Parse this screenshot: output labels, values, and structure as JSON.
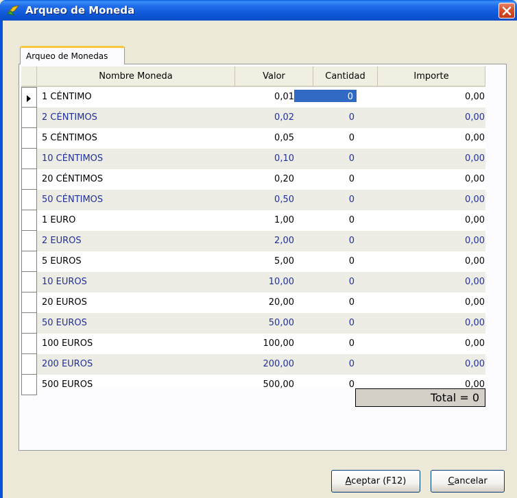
{
  "window": {
    "title": "Arqueo de Moneda",
    "title_color": "#FFFFFF",
    "titlebar_color": "#0A5FE3"
  },
  "tab": {
    "label": "Arqueo de Monedas"
  },
  "grid": {
    "columns": [
      "Nombre Moneda",
      "Valor",
      "Cantidad",
      "Importe"
    ],
    "rows": [
      {
        "nombre": "1 CÉNTIMO",
        "valor": "0,01",
        "cantidad": "0",
        "importe": "0,00"
      },
      {
        "nombre": "2 CÉNTIMOS",
        "valor": "0,02",
        "cantidad": "0",
        "importe": "0,00"
      },
      {
        "nombre": "5 CÉNTIMOS",
        "valor": "0,05",
        "cantidad": "0",
        "importe": "0,00"
      },
      {
        "nombre": "10 CÉNTIMOS",
        "valor": "0,10",
        "cantidad": "0",
        "importe": "0,00"
      },
      {
        "nombre": "20 CÉNTIMOS",
        "valor": "0,20",
        "cantidad": "0",
        "importe": "0,00"
      },
      {
        "nombre": "50 CÉNTIMOS",
        "valor": "0,50",
        "cantidad": "0",
        "importe": "0,00"
      },
      {
        "nombre": "1 EURO",
        "valor": "1,00",
        "cantidad": "0",
        "importe": "0,00"
      },
      {
        "nombre": "2 EUROS",
        "valor": "2,00",
        "cantidad": "0",
        "importe": "0,00"
      },
      {
        "nombre": "5 EUROS",
        "valor": "5,00",
        "cantidad": "0",
        "importe": "0,00"
      },
      {
        "nombre": "10 EUROS",
        "valor": "10,00",
        "cantidad": "0",
        "importe": "0,00"
      },
      {
        "nombre": "20 EUROS",
        "valor": "20,00",
        "cantidad": "0",
        "importe": "0,00"
      },
      {
        "nombre": "50 EUROS",
        "valor": "50,00",
        "cantidad": "0",
        "importe": "0,00"
      },
      {
        "nombre": "100 EUROS",
        "valor": "100,00",
        "cantidad": "0",
        "importe": "0,00"
      },
      {
        "nombre": "200 EUROS",
        "valor": "200,00",
        "cantidad": "0",
        "importe": "0,00"
      },
      {
        "nombre": "500 EUROS",
        "valor": "500,00",
        "cantidad": "0",
        "importe": "0,00"
      }
    ],
    "alt_row_text_color": "#1F2F9B",
    "selection_color": "#316AC5"
  },
  "total": {
    "text": "Total = 0"
  },
  "buttons": {
    "ok_prefix": "A",
    "ok_rest": "ceptar (F12)",
    "cancel_prefix": "C",
    "cancel_rest": "ancelar"
  },
  "icons": {
    "app": "app-icon",
    "close": "close-icon",
    "row_pointer": "row-pointer-icon"
  }
}
